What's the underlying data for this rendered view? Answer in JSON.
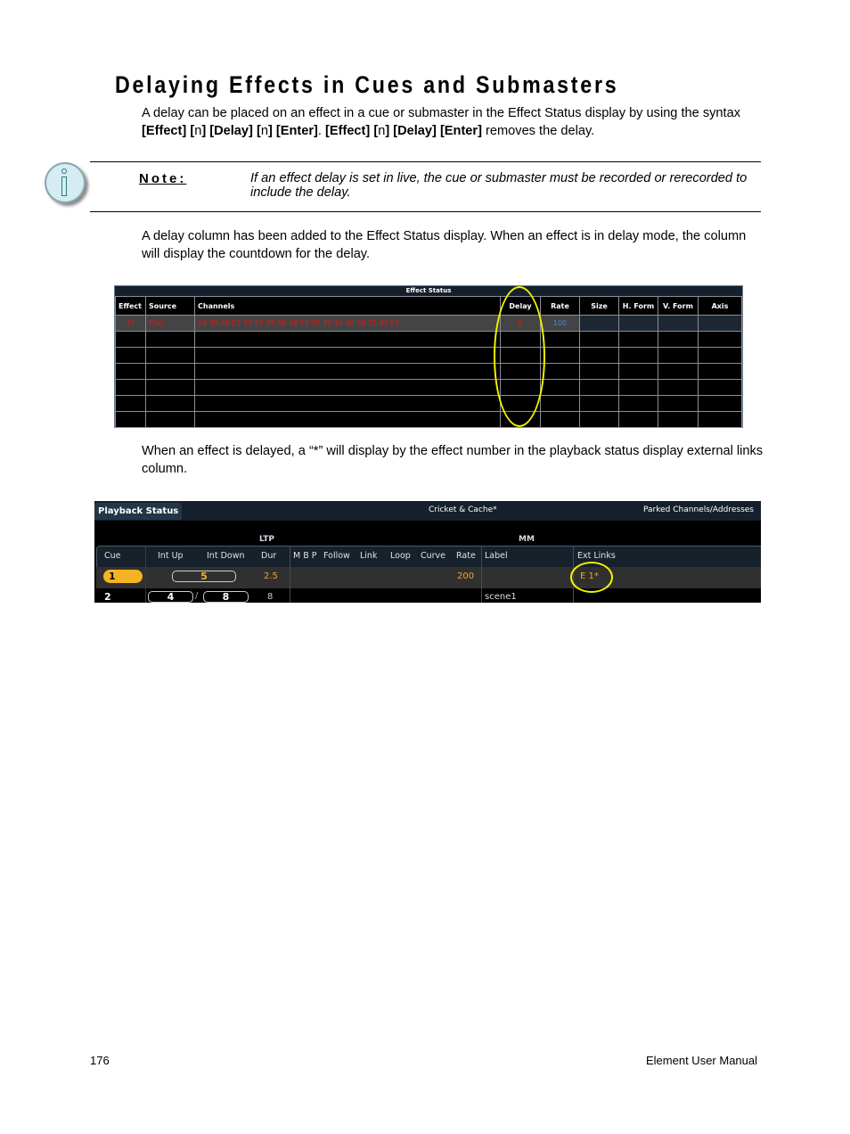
{
  "heading": "Delaying Effects in Cues and Submasters",
  "intro": {
    "parts": [
      {
        "t": "A delay can be placed on an effect in a cue or submaster in the Effect Status display by using the syntax ",
        "b": false
      },
      {
        "t": "[Effect] [",
        "b": true
      },
      {
        "t": "n",
        "b": false
      },
      {
        "t": "] [Delay] [",
        "b": true
      },
      {
        "t": "n",
        "b": false
      },
      {
        "t": "] [Enter]",
        "b": true
      },
      {
        "t": ". ",
        "b": false
      },
      {
        "t": "[Effect] [",
        "b": true
      },
      {
        "t": "n",
        "b": false
      },
      {
        "t": "] [Delay] [Enter]",
        "b": true
      },
      {
        "t": " removes the delay.",
        "b": false
      }
    ]
  },
  "note": {
    "icon": "info-icon",
    "label": "Note:",
    "text": "If an effect delay is set in live, the cue or submaster must be recorded or rerecorded to include the delay."
  },
  "paragraph2": "A delay column has been added to the Effect Status display. When an effect is in delay mode, the column will display the countdown for the delay.",
  "effect_status": {
    "title": "Effect Status",
    "columns": [
      "Effect",
      "Source",
      "Channels",
      "Delay",
      "Rate",
      "Size",
      "H. Form",
      "V. Form",
      "Axis"
    ],
    "rows": [
      {
        "effect": "1*",
        "source": "Man",
        "channels": "26  36  46  27  37  47  28  38  48  29  39  49  30  40  50  31  41  51",
        "delay": "5",
        "rate": "100",
        "size": "",
        "hform": "",
        "vform": "",
        "axis": ""
      }
    ],
    "empty_rows": 6,
    "colors": {
      "active_text": "#d61a1a",
      "rate_text": "#3a8fe0",
      "highlight": "#f2f200"
    }
  },
  "paragraph3": "When an effect is delayed, a “*” will display by the effect number in the playback status display external links column.",
  "playback_status": {
    "tab": "Playback Status",
    "show_name": "Cricket & Cache*",
    "right_tab": "Parked Channels/Addresses",
    "groups": {
      "ltp": "LTP",
      "mm": "MM"
    },
    "columns": [
      "Cue",
      "Int Up",
      "Int Down",
      "Dur",
      "M B P",
      "Follow",
      "Link",
      "Loop",
      "Curve",
      "Rate",
      "Label",
      "Ext Links"
    ],
    "rows": [
      {
        "cue": "1",
        "int_single": "5",
        "dur": "2.5",
        "rate": "200",
        "label": "",
        "ext_links": "E  1*"
      },
      {
        "cue": "2",
        "int_up": "4",
        "int_sep": "/",
        "int_down": "8",
        "dur": "8",
        "rate": "",
        "label": "scene1",
        "ext_links": ""
      }
    ],
    "colors": {
      "accent": "#f5b324",
      "value_text": "#e8a92a"
    }
  },
  "footer": {
    "page_number": "176",
    "manual_title": "Element User Manual"
  }
}
